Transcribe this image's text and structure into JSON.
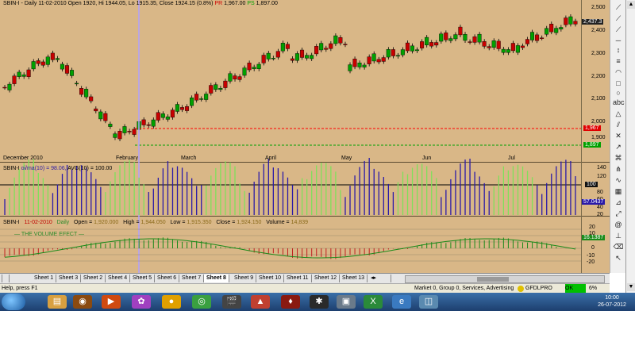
{
  "price_panel": {
    "symbol": "SBIN-I",
    "title_main": "SBIN-I - Daily 11-02-2010 Open 1920, Hi 1944.05, Lo 1915.35, Close 1924.15 (0.8%)",
    "pr_label": "PR",
    "pr_value": "1,967.00",
    "ps_label": "PS",
    "ps_value": "1,897.00",
    "y_ticks": [
      "2,500",
      "2,400",
      "2,300",
      "2,200",
      "2,100",
      "2,000",
      "1,900"
    ],
    "last_price": "2,437.3",
    "resistance_badge": "1,967",
    "support_badge": "1,897",
    "months": [
      "December 2010",
      "February",
      "March",
      "April",
      "May",
      "Jun",
      "Jul"
    ]
  },
  "osc_panel": {
    "symbol": "SBIN-I",
    "formula": "oi/ma(10) = 98.06,",
    "avg_label": "AVG(10) = 100.00",
    "y_ticks": [
      "140",
      "120",
      "100",
      "80",
      "60",
      "40",
      "20"
    ],
    "level_badge": "100",
    "value_badge": "57.0437"
  },
  "volume_panel": {
    "symbol": "SBIN-I",
    "date": "11-02-2010",
    "period": "Daily",
    "open_label": "Open =",
    "open_value": "1,920.000",
    "high_label": "High =",
    "high_value": "1,944.050",
    "low_label": "Low =",
    "low_value": "1,915.350",
    "close_label": "Close =",
    "close_value": "1,924.150",
    "volume_label": "Volume =",
    "volume_value": "14,839",
    "legend": "THE VOLUME EFECT",
    "y_ticks": [
      "20",
      "10",
      "0",
      "-10",
      "-20"
    ],
    "value_badge": "16.1387"
  },
  "sheets": [
    "Sheet 1",
    "Sheet 3",
    "Sheet 2",
    "Sheet 4",
    "Sheet 5",
    "Sheet 6",
    "Sheet 7",
    "Sheet 8",
    "Sheet 9",
    "Sheet 10",
    "Sheet 11",
    "Sheet 12",
    "Sheet 13"
  ],
  "active_sheet": "Sheet 8",
  "status": {
    "help": "Help, press F1",
    "market": "Market 0, Group 0, Services, Advertising",
    "server": "GFDLPRO",
    "conn": "OK",
    "pct": "6%"
  },
  "clock": {
    "time": "10:00",
    "date": "26-07-2012"
  },
  "colors": {
    "chart_bg": "#d9b787",
    "bull": "#00a000",
    "bear": "#c80000",
    "osc_up": "#7fe05a",
    "osc_down": "#2a1aa8",
    "resistance": "#ff0000",
    "support": "#00a000"
  }
}
